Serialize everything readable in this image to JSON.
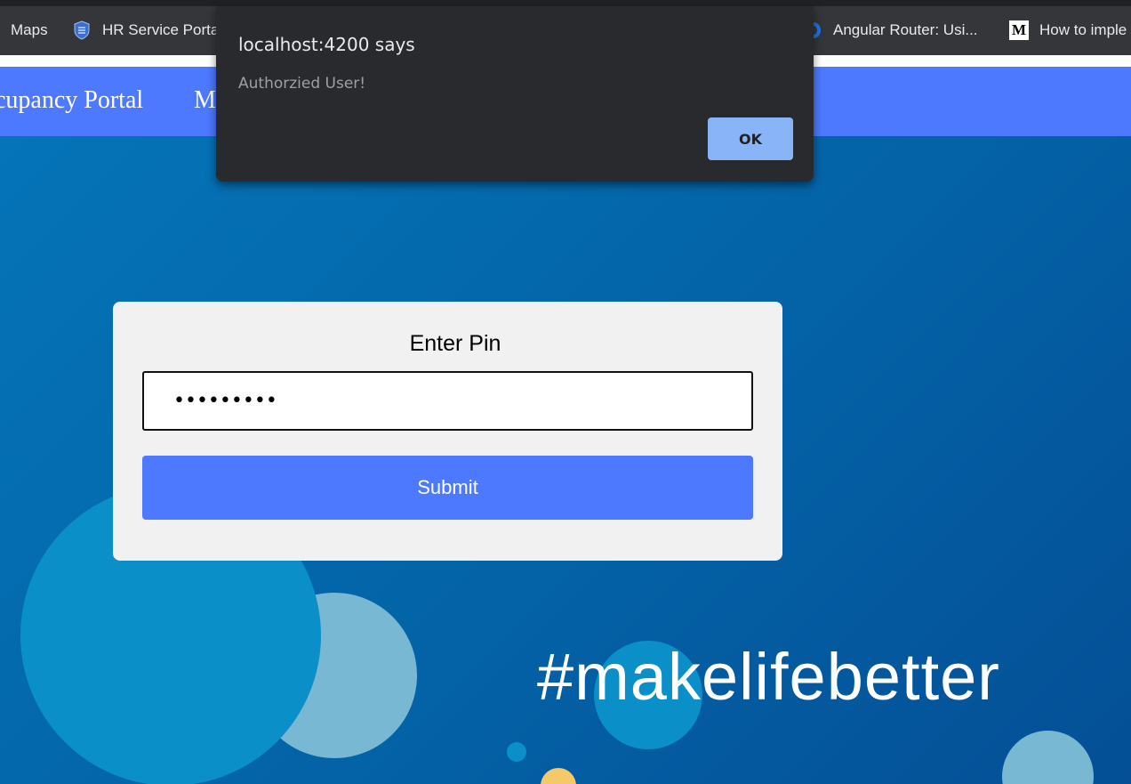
{
  "bookmarks": [
    {
      "label": "Maps",
      "icon": "maps-bookmark"
    },
    {
      "label": "HR Service Porta",
      "icon": "shield-icon"
    },
    {
      "label": "Angular Router: Usi...",
      "icon": "angular-icon"
    },
    {
      "label": "How to imple",
      "icon": "medium-icon"
    }
  ],
  "navbar": {
    "title": "cupancy Portal",
    "item": "M"
  },
  "alert": {
    "title": "localhost:4200 says",
    "message": "Authorzied User!",
    "ok_label": "OK"
  },
  "pin_form": {
    "heading": "Enter Pin",
    "pin_value": "•••••••••",
    "submit_label": "Submit"
  },
  "hero": {
    "hashtag": "#makelifebetter"
  },
  "colors": {
    "navbar": "#4d79ff",
    "hero": "#0069ad",
    "dialog": "#292a2d",
    "ok_button": "#8ab4f8"
  }
}
